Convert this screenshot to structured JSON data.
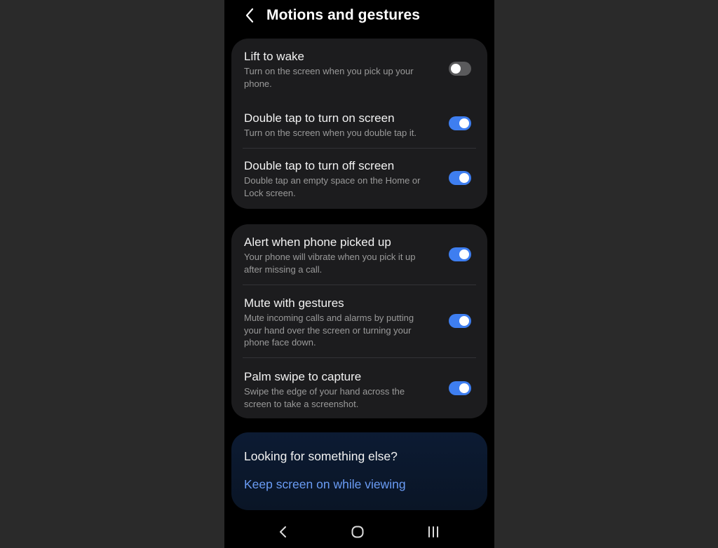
{
  "header": {
    "title": "Motions and gestures"
  },
  "sections": {
    "group1": [
      {
        "title": "Lift to wake",
        "description": "Turn on the screen when you pick up your phone.",
        "enabled": false
      },
      {
        "title": "Double tap to turn on screen",
        "description": "Turn on the screen when you double tap it.",
        "enabled": true
      },
      {
        "title": "Double tap to turn off screen",
        "description": "Double tap an empty space on the Home or Lock screen.",
        "enabled": true
      }
    ],
    "group2": [
      {
        "title": "Alert when phone picked up",
        "description": "Your phone will vibrate when you pick it up after missing a call.",
        "enabled": true
      },
      {
        "title": "Mute with gestures",
        "description": "Mute incoming calls and alarms by putting your hand over the screen or turning your phone face down.",
        "enabled": true
      },
      {
        "title": "Palm swipe to capture",
        "description": "Swipe the edge of your hand across the screen to take a screenshot.",
        "enabled": true
      }
    ]
  },
  "suggestions": {
    "title": "Looking for something else?",
    "link": "Keep screen on while viewing"
  },
  "colors": {
    "accent": "#3e7ef0",
    "link": "#6a9cf5",
    "card": "#1c1c1e",
    "background": "#000000"
  },
  "icons": {
    "back": "chevron-left-icon",
    "nav_back": "nav-back-icon",
    "nav_home": "nav-home-icon",
    "nav_recents": "nav-recents-icon"
  }
}
